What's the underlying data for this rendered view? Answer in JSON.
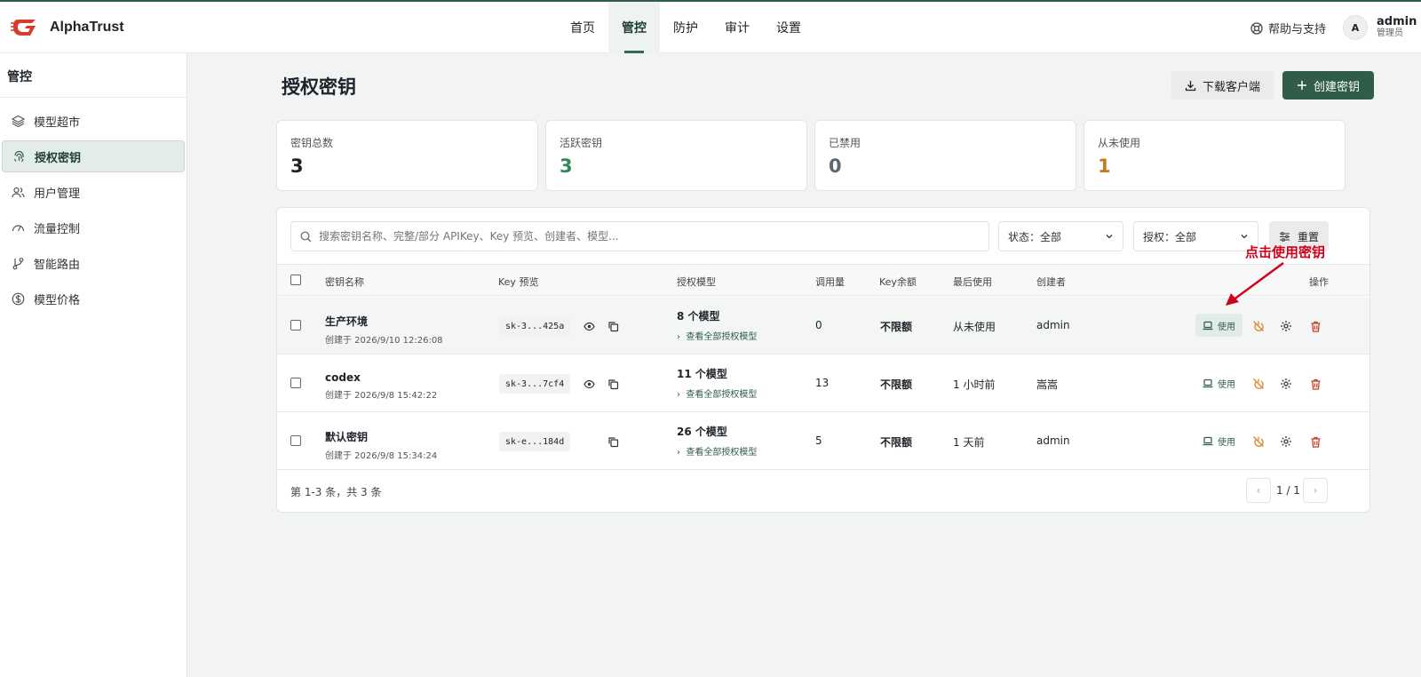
{
  "brand": {
    "name": "AlphaTrust",
    "accent": "#2f5d4a",
    "logo_color": "#d93a2b"
  },
  "nav": {
    "items": [
      "首页",
      "管控",
      "防护",
      "审计",
      "设置"
    ],
    "active": 1
  },
  "header": {
    "help": "帮助与支持",
    "avatar_letter": "A",
    "user_name": "admin",
    "user_role": "管理员"
  },
  "sidebar": {
    "title": "管控",
    "items": [
      {
        "label": "模型超市",
        "icon": "layers-icon"
      },
      {
        "label": "授权密钥",
        "icon": "fingerprint-icon",
        "active": true
      },
      {
        "label": "用户管理",
        "icon": "users-icon"
      },
      {
        "label": "流量控制",
        "icon": "gauge-icon"
      },
      {
        "label": "智能路由",
        "icon": "git-branch-icon"
      },
      {
        "label": "模型价格",
        "icon": "dollar-icon"
      }
    ]
  },
  "page": {
    "title": "授权密钥",
    "download_label": "下载客户端",
    "create_label": "创建密钥"
  },
  "stats": [
    {
      "label": "密钥总数",
      "value": "3",
      "color": "#1f2329"
    },
    {
      "label": "活跃密钥",
      "value": "3",
      "color": "#2e8b57"
    },
    {
      "label": "已禁用",
      "value": "0",
      "color": "#5a6670"
    },
    {
      "label": "从未使用",
      "value": "1",
      "color": "#c77a1e"
    }
  ],
  "filters": {
    "search_placeholder": "搜索密钥名称、完整/部分 APIKey、Key 预览、创建者、模型...",
    "status": "状态：全部",
    "auth": "授权：全部",
    "reset": "重置"
  },
  "table": {
    "headers": [
      "密钥名称",
      "Key 预览",
      "授权模型",
      "调用量",
      "Key余额",
      "最后使用",
      "创建者",
      "操作"
    ],
    "view_all": "查看全部授权模型",
    "use_label": "使用",
    "rows": [
      {
        "name": "生产环境",
        "created": "创建于 2026/9/10 12:26:08",
        "key": "sk-3...425a",
        "models": "8 个模型",
        "calls": "0",
        "balance": "不限额",
        "last_used": "从未使用",
        "creator": "admin"
      },
      {
        "name": "codex",
        "created": "创建于 2026/9/8 15:42:22",
        "key": "sk-3...7cf4",
        "models": "11 个模型",
        "calls": "13",
        "balance": "不限额",
        "last_used": "1 小时前",
        "creator": "嵩嵩"
      },
      {
        "name": "默认密钥",
        "created": "创建于 2026/9/8 15:34:24",
        "key": "sk-e...184d",
        "models": "26 个模型",
        "calls": "5",
        "balance": "不限额",
        "last_used": "1 天前",
        "creator": "admin"
      }
    ]
  },
  "footer": {
    "summary": "第 1-3 条，共 3 条",
    "page": "1 / 1"
  },
  "annotation": {
    "text": "点击使用密钥",
    "color": "#d0021b"
  }
}
